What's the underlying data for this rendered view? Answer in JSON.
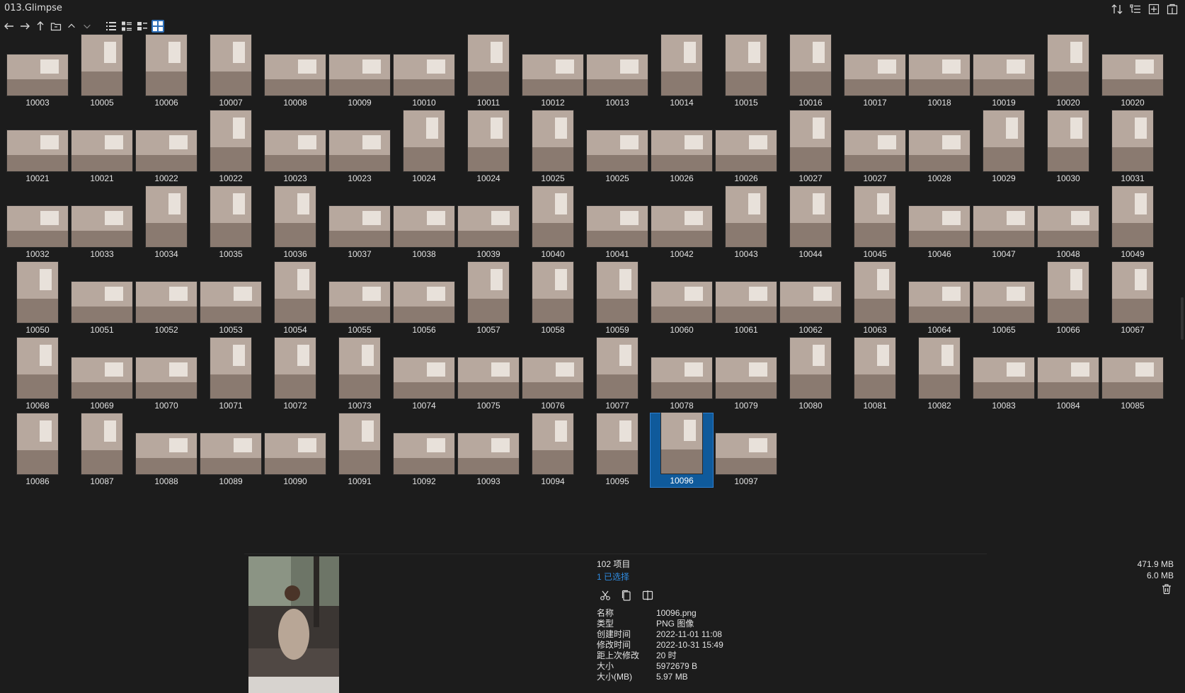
{
  "window": {
    "title": "013.Glimpse"
  },
  "toolbar": {
    "nav": [
      "back-arrow-icon",
      "forward-arrow-icon",
      "up-arrow-icon",
      "folder-icon",
      "chevron-up-icon",
      "chevron-down-icon"
    ],
    "views": [
      "list-view-icon",
      "details-view-icon",
      "tiles-view-icon",
      "thumbnails-view-icon"
    ],
    "active_view": "thumbnails-view-icon"
  },
  "top_right": [
    "sort-icon",
    "tree-icon",
    "new-tab-icon",
    "panel-icon"
  ],
  "files": [
    "10003",
    "10005",
    "10006",
    "10007",
    "10008",
    "10009",
    "10010",
    "10011",
    "10012",
    "10013",
    "10014",
    "10015",
    "10016",
    "10017",
    "10018",
    "10019",
    "10020",
    "10020",
    "10021",
    "10021",
    "10022",
    "10022",
    "10023",
    "10023",
    "10024",
    "10024",
    "10025",
    "10025",
    "10026",
    "10026",
    "10027",
    "10027",
    "10028",
    "10029",
    "10030",
    "10031",
    "10032",
    "10033",
    "10034",
    "10035",
    "10036",
    "10037",
    "10038",
    "10039",
    "10040",
    "10041",
    "10042",
    "10043",
    "10044",
    "10045",
    "10046",
    "10047",
    "10048",
    "10049",
    "10050",
    "10051",
    "10052",
    "10053",
    "10054",
    "10055",
    "10056",
    "10057",
    "10058",
    "10059",
    "10060",
    "10061",
    "10062",
    "10063",
    "10064",
    "10065",
    "10066",
    "10067",
    "10068",
    "10069",
    "10070",
    "10071",
    "10072",
    "10073",
    "10074",
    "10075",
    "10076",
    "10077",
    "10078",
    "10079",
    "10080",
    "10081",
    "10082",
    "10083",
    "10084",
    "10085",
    "10086",
    "10087",
    "10088",
    "10089",
    "10090",
    "10091",
    "10092",
    "10093",
    "10094",
    "10095",
    "10096",
    "10097"
  ],
  "selected_file": "10096",
  "status": {
    "item_count": "102 项目",
    "selected_count": "1 已选择",
    "total_size": "471.9 MB",
    "selected_size": "6.0 MB"
  },
  "actions": [
    "cut-icon",
    "copy-icon",
    "compare-icon"
  ],
  "properties": [
    {
      "key": "名称",
      "value": "10096.png"
    },
    {
      "key": "类型",
      "value": "PNG 图像"
    },
    {
      "key": "创建时间",
      "value": "2022-11-01  11:08"
    },
    {
      "key": "修改时间",
      "value": "2022-10-31  15:49"
    },
    {
      "key": "距上次修改",
      "value": "20 时"
    },
    {
      "key": "大小",
      "value": "5972679 B"
    },
    {
      "key": "大小(MB)",
      "value": "5.97 MB"
    }
  ],
  "colors": {
    "background": "#1c1c1c",
    "selection": "#0f5a9b",
    "accent_text": "#2f8be0"
  }
}
